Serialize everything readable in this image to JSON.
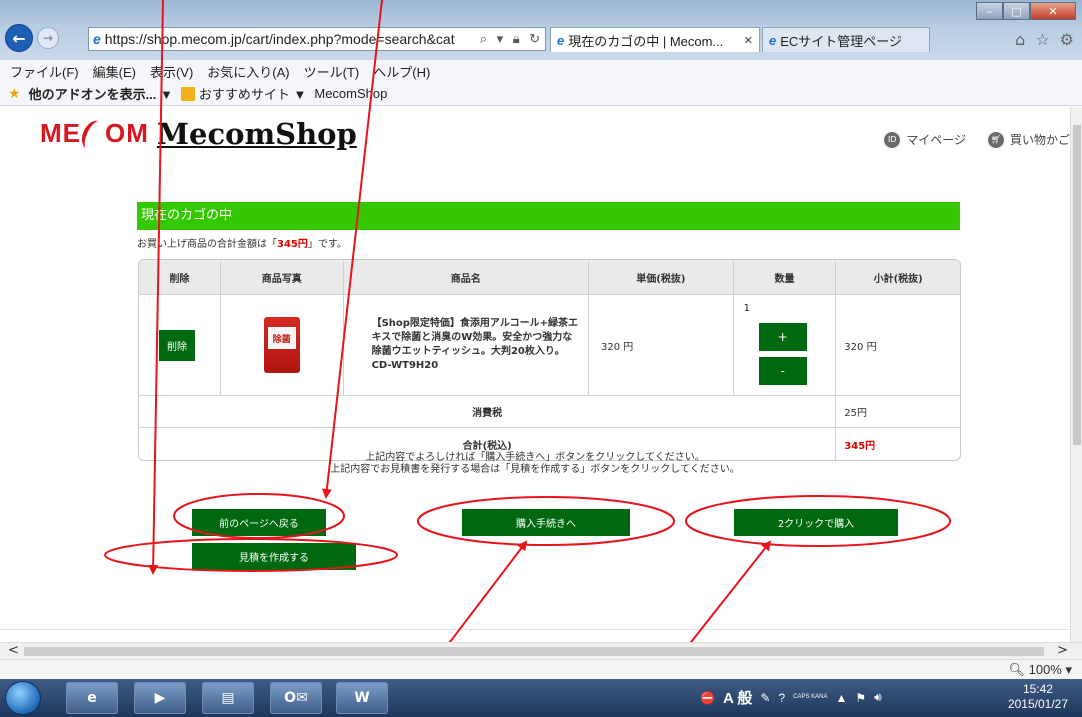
{
  "browser": {
    "url": "https://shop.mecom.jp/cart/index.php?mode=search&cat",
    "tabs": [
      {
        "label": "現在のカゴの中 | Mecom...",
        "active": true
      },
      {
        "label": "ECサイト管理ページ",
        "active": false
      }
    ],
    "menu": [
      "ファイル(F)",
      "編集(E)",
      "表示(V)",
      "お気に入り(A)",
      "ツール(T)",
      "ヘルプ(H)"
    ],
    "favorites": [
      "他のアドオンを表示... ▼",
      "おすすめサイト ▼",
      "MecomShop"
    ]
  },
  "header": {
    "logo_mark_left": "ME",
    "logo_mark_right": "OM",
    "logo_text": "MecomShop",
    "mypage": "マイページ",
    "cart": "買い物かご"
  },
  "cart": {
    "heading": "現在のカゴの中",
    "total_prefix": "お買い上げ商品の合計金額は「",
    "total_amount": "345円",
    "total_suffix": "」です。",
    "columns": [
      "削除",
      "商品写真",
      "商品名",
      "単価(税抜)",
      "数量",
      "小計(税抜)"
    ],
    "item": {
      "delete_label": "削除",
      "image_text": "除菌",
      "name": "【Shop限定特価】食添用アルコール+緑茶エキスで除菌と消臭のW効果。安全かつ強力な除菌ウエットティッシュ。大判20枚入り。 CD-WT9H20",
      "price": "320 円",
      "qty": "1",
      "plus": "+",
      "minus": "-",
      "subtotal": "320 円"
    },
    "tax_label": "消費税",
    "tax_value": "25円",
    "total_label": "合計(税込)",
    "total_value": "345円"
  },
  "notice": {
    "line1": "上記内容でよろしければ「購入手続きへ」ボタンをクリックしてください。",
    "line2": "上記内容でお見積書を発行する場合は「見積を作成する」ボタンをクリックしてください。"
  },
  "buttons": {
    "back": "前のページへ戻る",
    "proceed": "購入手続きへ",
    "two_click": "2クリックで購入",
    "estimate": "見積を作成する"
  },
  "statusbar": {
    "zoom": "100%"
  },
  "taskbar": {
    "ime": "A 般",
    "caps": "CAPS KANA",
    "time": "15:42",
    "date": "2015/01/27"
  },
  "colors": {
    "accent_green": "#33c800",
    "button_green": "#00690f",
    "price_red": "#e50000",
    "annotation_red": "#e8141b"
  }
}
